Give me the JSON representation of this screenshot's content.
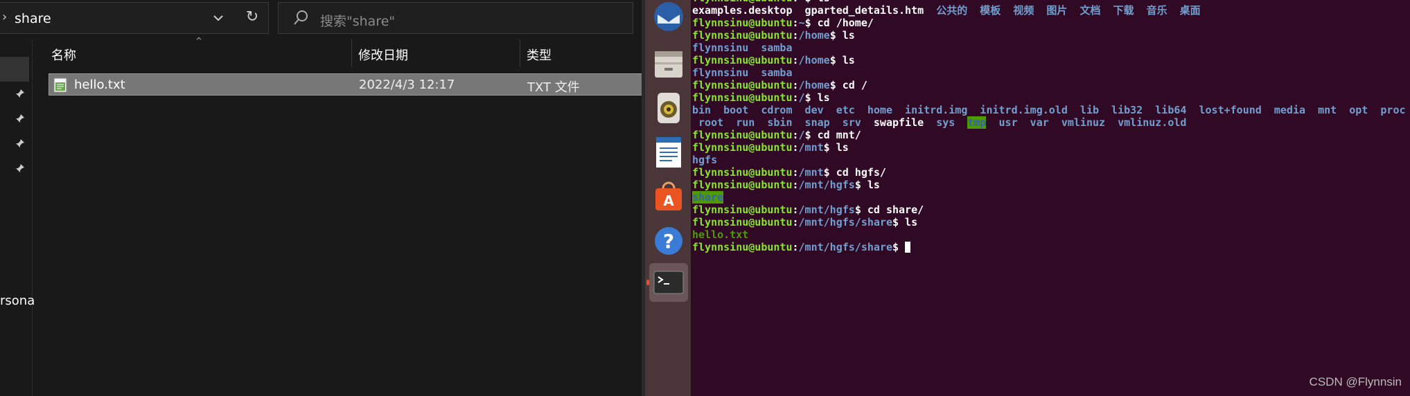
{
  "explorer": {
    "breadcrumb": "share",
    "search_placeholder": "搜索\"share\"",
    "columns": [
      "名称",
      "修改日期",
      "类型"
    ],
    "files": [
      {
        "name": "hello.txt",
        "date": "2022/4/3 12:17",
        "type": "TXT 文件"
      }
    ],
    "nav_partial_label": "rsona"
  },
  "launcher": {
    "items": [
      "thunderbird-icon",
      "files-icon",
      "rhythmbox-icon",
      "writer-icon",
      "software-center-icon",
      "help-icon",
      "terminal-icon"
    ]
  },
  "terminal": {
    "lines": [
      {
        "segs": [
          {
            "c": "p",
            "t": "flynnsinu@ubuntu"
          },
          {
            "c": "t",
            "t": ":"
          },
          {
            "c": "d",
            "t": "~"
          },
          {
            "c": "t",
            "t": "$ ls"
          }
        ]
      },
      {
        "segs": [
          {
            "c": "t",
            "t": "examples.desktop  gparted_details.htm  "
          },
          {
            "c": "d",
            "t": "公共的  模板  视频  图片  文档  下载  音乐  桌面"
          }
        ]
      },
      {
        "segs": [
          {
            "c": "p",
            "t": "flynnsinu@ubuntu"
          },
          {
            "c": "t",
            "t": ":"
          },
          {
            "c": "d",
            "t": "~"
          },
          {
            "c": "t",
            "t": "$ cd /home/"
          }
        ]
      },
      {
        "segs": [
          {
            "c": "p",
            "t": "flynnsinu@ubuntu"
          },
          {
            "c": "t",
            "t": ":"
          },
          {
            "c": "d",
            "t": "/home"
          },
          {
            "c": "t",
            "t": "$ ls"
          }
        ]
      },
      {
        "segs": [
          {
            "c": "d",
            "t": "flynnsinu  samba"
          }
        ]
      },
      {
        "segs": [
          {
            "c": "p",
            "t": "flynnsinu@ubuntu"
          },
          {
            "c": "t",
            "t": ":"
          },
          {
            "c": "d",
            "t": "/home"
          },
          {
            "c": "t",
            "t": "$ ls"
          }
        ]
      },
      {
        "segs": [
          {
            "c": "d",
            "t": "flynnsinu  samba"
          }
        ]
      },
      {
        "segs": [
          {
            "c": "p",
            "t": "flynnsinu@ubuntu"
          },
          {
            "c": "t",
            "t": ":"
          },
          {
            "c": "d",
            "t": "/home"
          },
          {
            "c": "t",
            "t": "$ cd /"
          }
        ]
      },
      {
        "segs": [
          {
            "c": "p",
            "t": "flynnsinu@ubuntu"
          },
          {
            "c": "t",
            "t": ":"
          },
          {
            "c": "d",
            "t": "/"
          },
          {
            "c": "t",
            "t": "$ ls"
          }
        ]
      },
      {
        "segs": [
          {
            "c": "d",
            "t": "bin  boot  cdrom  dev  etc  home  initrd.img  initrd.img.old  lib  lib32  lib64  lost+found  media  mnt  opt  proc"
          }
        ]
      },
      {
        "segs": [
          {
            "c": "d",
            "t": " root  run  sbin  snap  srv  "
          },
          {
            "c": "t",
            "t": "swapfile  "
          },
          {
            "c": "d",
            "t": "sys  "
          },
          {
            "c": "hl",
            "t": "tmp"
          },
          {
            "c": "d",
            "t": "  usr  var  "
          },
          {
            "c": "d",
            "t": "vmlinuz  vmlinuz.old"
          }
        ]
      },
      {
        "segs": [
          {
            "c": "p",
            "t": "flynnsinu@ubuntu"
          },
          {
            "c": "t",
            "t": ":"
          },
          {
            "c": "d",
            "t": "/"
          },
          {
            "c": "t",
            "t": "$ cd mnt/"
          }
        ]
      },
      {
        "segs": [
          {
            "c": "p",
            "t": "flynnsinu@ubuntu"
          },
          {
            "c": "t",
            "t": ":"
          },
          {
            "c": "d",
            "t": "/mnt"
          },
          {
            "c": "t",
            "t": "$ ls"
          }
        ]
      },
      {
        "segs": [
          {
            "c": "d",
            "t": "hgfs"
          }
        ]
      },
      {
        "segs": [
          {
            "c": "p",
            "t": "flynnsinu@ubuntu"
          },
          {
            "c": "t",
            "t": ":"
          },
          {
            "c": "d",
            "t": "/mnt"
          },
          {
            "c": "t",
            "t": "$ cd hgfs/"
          }
        ]
      },
      {
        "segs": [
          {
            "c": "p",
            "t": "flynnsinu@ubuntu"
          },
          {
            "c": "t",
            "t": ":"
          },
          {
            "c": "d",
            "t": "/mnt/hgfs"
          },
          {
            "c": "t",
            "t": "$ ls"
          }
        ]
      },
      {
        "segs": [
          {
            "c": "hl",
            "t": "share"
          }
        ]
      },
      {
        "segs": [
          {
            "c": "p",
            "t": "flynnsinu@ubuntu"
          },
          {
            "c": "t",
            "t": ":"
          },
          {
            "c": "d",
            "t": "/mnt/hgfs"
          },
          {
            "c": "t",
            "t": "$ cd share/"
          }
        ]
      },
      {
        "segs": [
          {
            "c": "p",
            "t": "flynnsinu@ubuntu"
          },
          {
            "c": "t",
            "t": ":"
          },
          {
            "c": "d",
            "t": "/mnt/hgfs/share"
          },
          {
            "c": "t",
            "t": "$ ls"
          }
        ]
      },
      {
        "segs": [
          {
            "c": "e",
            "t": "hello.txt"
          }
        ]
      },
      {
        "segs": [
          {
            "c": "p",
            "t": "flynnsinu@ubuntu"
          },
          {
            "c": "t",
            "t": ":"
          },
          {
            "c": "d",
            "t": "/mnt/hgfs/share"
          },
          {
            "c": "t",
            "t": "$ "
          }
        ],
        "cursor": true
      }
    ],
    "watermark": "CSDN @Flynnsin"
  }
}
